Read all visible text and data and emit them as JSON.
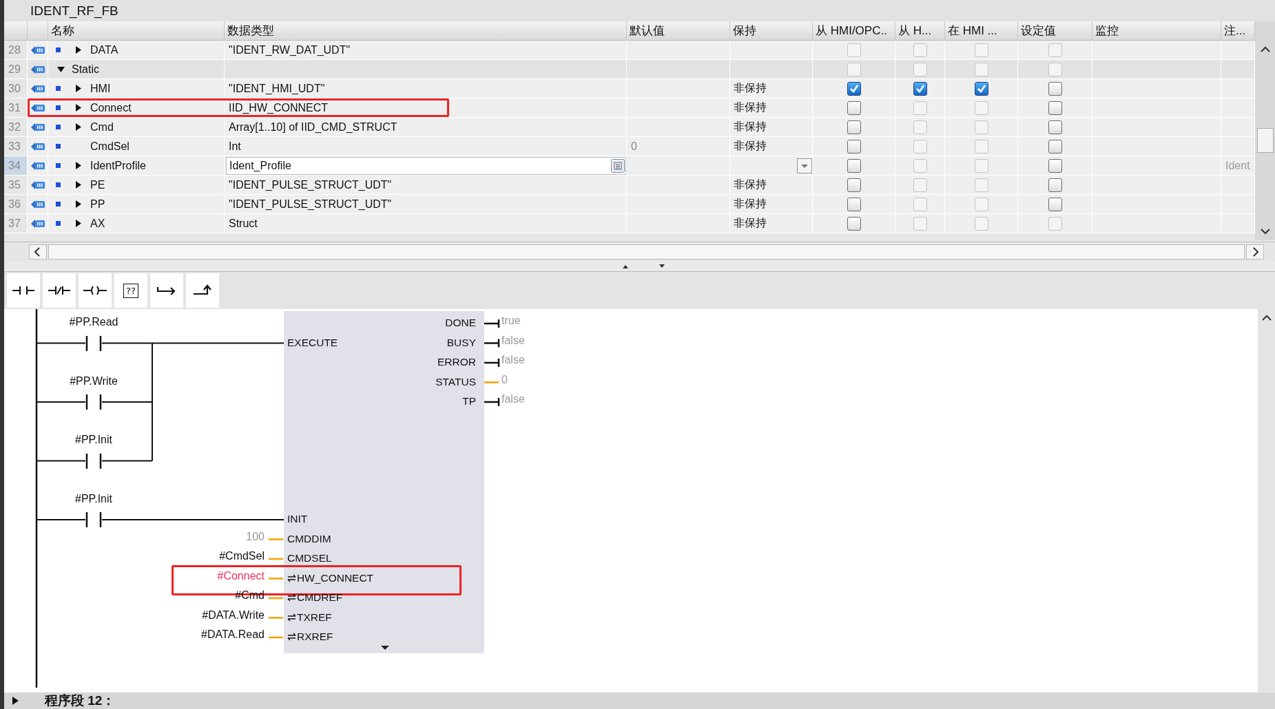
{
  "title": "IDENT_RF_FB",
  "columns": [
    "名称",
    "数据类型",
    "默认值",
    "保持",
    "从 HMI/OPC..",
    "从 H...",
    "在 HMI ...",
    "设定值",
    "监控",
    "注..."
  ],
  "rows": [
    {
      "num": "28",
      "expanded": false,
      "member": true,
      "name": "DATA",
      "datatype": "\"IDENT_RW_DAT_UDT\"",
      "checks": [
        {
          "checked": false,
          "disabled": true
        },
        {
          "checked": false,
          "disabled": true
        },
        {
          "checked": false,
          "disabled": true
        },
        {
          "checked": false,
          "disabled": true
        }
      ],
      "editing": false,
      "highlighted": false
    },
    {
      "num": "29",
      "expanded": true,
      "member": false,
      "name": "Static",
      "checks": [
        {
          "checked": false,
          "disabled": true
        },
        {
          "checked": false,
          "disabled": true
        },
        {
          "checked": false,
          "disabled": true
        },
        {
          "checked": false,
          "disabled": true
        }
      ],
      "editing": false,
      "highlighted": false
    },
    {
      "num": "30",
      "expanded": false,
      "member": true,
      "name": "HMI",
      "datatype": "\"IDENT_HMI_UDT\"",
      "retain": "非保持",
      "checks": [
        {
          "checked": true,
          "disabled": false
        },
        {
          "checked": true,
          "disabled": false
        },
        {
          "checked": true,
          "disabled": false
        },
        {
          "checked": false,
          "disabled": false
        }
      ],
      "editing": false,
      "highlighted": false
    },
    {
      "num": "31",
      "expanded": false,
      "member": true,
      "name": "Connect",
      "datatype": "IID_HW_CONNECT",
      "retain": "非保持",
      "checks": [
        {
          "checked": false,
          "disabled": false
        },
        {
          "checked": false,
          "disabled": true
        },
        {
          "checked": false,
          "disabled": true
        },
        {
          "checked": false,
          "disabled": false
        }
      ],
      "editing": false,
      "highlighted": true
    },
    {
      "num": "32",
      "expanded": false,
      "member": true,
      "name": "Cmd",
      "datatype": "Array[1..10] of IID_CMD_STRUCT",
      "retain": "非保持",
      "checks": [
        {
          "checked": false,
          "disabled": false
        },
        {
          "checked": false,
          "disabled": true
        },
        {
          "checked": false,
          "disabled": true
        },
        {
          "checked": false,
          "disabled": false
        }
      ],
      "editing": false,
      "highlighted": false
    },
    {
      "num": "33",
      "member": true,
      "name": "CmdSel",
      "datatype": "Int",
      "default": "0",
      "retain": "非保持",
      "checks": [
        {
          "checked": false,
          "disabled": false
        },
        {
          "checked": false,
          "disabled": true
        },
        {
          "checked": false,
          "disabled": true
        },
        {
          "checked": false,
          "disabled": false
        }
      ],
      "editing": false,
      "highlighted": false
    },
    {
      "num": "34",
      "expanded": false,
      "member": true,
      "name": "IdentProfile",
      "datatype": "Ident_Profile",
      "checks": [
        {
          "checked": false,
          "disabled": false
        },
        {
          "checked": false,
          "disabled": true
        },
        {
          "checked": false,
          "disabled": true
        },
        {
          "checked": false,
          "disabled": false
        }
      ],
      "comment": "Ident",
      "editing": true,
      "highlighted": false
    },
    {
      "num": "35",
      "expanded": false,
      "member": true,
      "name": "PE",
      "datatype": "\"IDENT_PULSE_STRUCT_UDT\"",
      "retain": "非保持",
      "checks": [
        {
          "checked": false,
          "disabled": false
        },
        {
          "checked": false,
          "disabled": true
        },
        {
          "checked": false,
          "disabled": true
        },
        {
          "checked": false,
          "disabled": false
        }
      ],
      "editing": false,
      "highlighted": false
    },
    {
      "num": "36",
      "expanded": false,
      "member": true,
      "name": "PP",
      "datatype": "\"IDENT_PULSE_STRUCT_UDT\"",
      "retain": "非保持",
      "checks": [
        {
          "checked": false,
          "disabled": false
        },
        {
          "checked": false,
          "disabled": true
        },
        {
          "checked": false,
          "disabled": true
        },
        {
          "checked": false,
          "disabled": false
        }
      ],
      "editing": false,
      "highlighted": false
    },
    {
      "num": "37",
      "expanded": false,
      "member": true,
      "name": "AX",
      "datatype": "Struct",
      "retain": "非保持",
      "checks": [
        {
          "checked": false,
          "disabled": false
        },
        {
          "checked": false,
          "disabled": true
        },
        {
          "checked": false,
          "disabled": true
        },
        {
          "checked": false,
          "disabled": true
        }
      ],
      "editing": false,
      "highlighted": false
    }
  ],
  "toolbar": [
    {
      "kind": "no_contact"
    },
    {
      "kind": "nc_contact"
    },
    {
      "kind": "coil"
    },
    {
      "kind": "box",
      "label": "??"
    },
    {
      "kind": "branch_open"
    },
    {
      "kind": "branch_close"
    }
  ],
  "block": {
    "inputs": [
      {
        "kind": "rung",
        "name": "EXECUTE",
        "contacts": [
          "#PP.Read",
          "#PP.Write",
          "#PP.Init"
        ],
        "highlighted": false
      },
      {
        "kind": "rung",
        "name": "INIT",
        "contacts": [
          "#PP.Init"
        ],
        "highlighted": false
      },
      {
        "kind": "constant",
        "name": "CMDDIM",
        "operand": "100",
        "error": false,
        "highlighted": false
      },
      {
        "kind": "value",
        "name": "CMDSEL",
        "operand": "#CmdSel",
        "error": false,
        "highlighted": false
      },
      {
        "kind": "inout",
        "name": "HW_CONNECT",
        "operand": "#Connect",
        "error": true,
        "highlighted": true
      },
      {
        "kind": "inout",
        "name": "CMDREF",
        "operand": "#Cmd",
        "error": false,
        "highlighted": false
      },
      {
        "kind": "inout",
        "name": "TXREF",
        "operand": "#DATA.Write",
        "error": false,
        "highlighted": false
      },
      {
        "kind": "inout",
        "name": "RXREF",
        "operand": "#DATA.Read",
        "error": false,
        "highlighted": false
      }
    ],
    "outputs": [
      {
        "kind": "bool",
        "name": "DONE",
        "value": "true"
      },
      {
        "kind": "bool",
        "name": "BUSY",
        "value": "false"
      },
      {
        "kind": "bool",
        "name": "ERROR",
        "value": "false"
      },
      {
        "kind": "word",
        "name": "STATUS",
        "value": "0"
      },
      {
        "kind": "bool",
        "name": "TP",
        "value": "false"
      }
    ]
  },
  "network": {
    "title": "程序段 12：",
    "expanded": false
  }
}
